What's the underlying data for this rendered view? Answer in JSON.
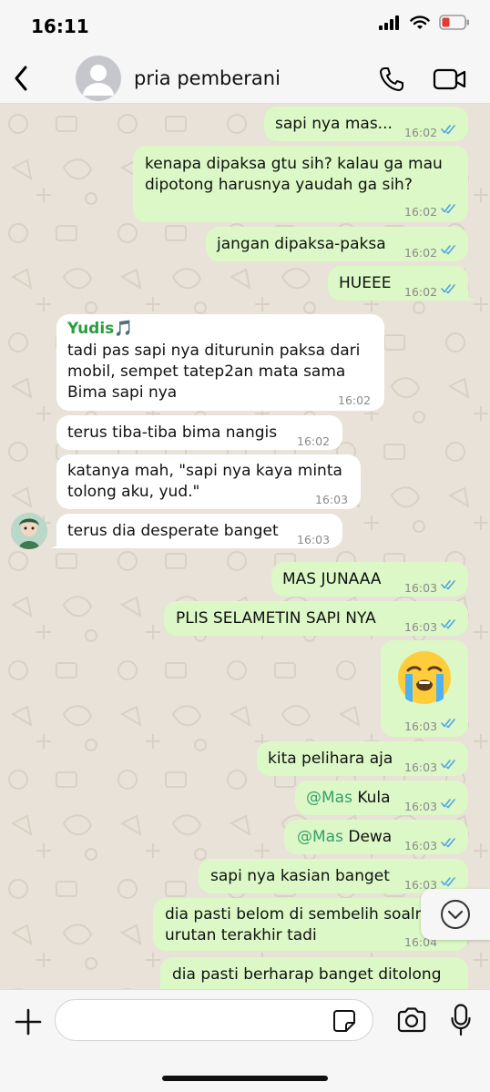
{
  "status_bar": {
    "time": "16:11"
  },
  "header": {
    "contact_name": "pria pemberani"
  },
  "messages": [
    {
      "dir": "out",
      "text": "sapi nya mas...",
      "time": "16:02"
    },
    {
      "dir": "out",
      "lines": [
        "kenapa dipaksa gtu sih? kalau ga mau",
        "dipotong harusnya yaudah ga sih?"
      ],
      "time": "16:02"
    },
    {
      "dir": "out",
      "text": "jangan dipaksa-paksa",
      "time": "16:02"
    },
    {
      "dir": "out",
      "text": "HUEEE",
      "time": "16:02"
    },
    {
      "dir": "in",
      "sender": "Yudis🎵",
      "lines": [
        "tadi pas sapi nya diturunin paksa dari",
        "mobil, sempet tatep2an mata sama",
        "Bima sapi nya"
      ],
      "time": "16:02"
    },
    {
      "dir": "in",
      "text": "terus tiba-tiba bima nangis",
      "time": "16:02"
    },
    {
      "dir": "in",
      "lines": [
        "katanya mah, \"sapi nya kaya minta",
        "tolong aku, yud.\""
      ],
      "time": "16:03"
    },
    {
      "dir": "in",
      "text": "terus dia desperate banget",
      "time": "16:03"
    },
    {
      "dir": "out",
      "text": "MAS JUNAAA",
      "time": "16:03"
    },
    {
      "dir": "out",
      "text": "PLIS SELAMETIN SAPI NYA",
      "time": "16:03"
    },
    {
      "dir": "out",
      "emoji": "😭",
      "time": "16:03"
    },
    {
      "dir": "out",
      "text": "kita pelihara aja",
      "time": "16:03"
    },
    {
      "dir": "out",
      "mention": "@Mas",
      "rest": " Kula",
      "time": "16:03"
    },
    {
      "dir": "out",
      "mention": "@Mas",
      "rest": " Dewa",
      "time": "16:03"
    },
    {
      "dir": "out",
      "text": "sapi nya kasian banget",
      "time": "16:03"
    },
    {
      "dir": "out",
      "lines": [
        "dia pasti belom di sembelih soalnya",
        "urutan terakhir tadi"
      ],
      "time": "16:04"
    },
    {
      "dir": "out",
      "text": "dia pasti berharap banget ditolong",
      "time": ""
    }
  ],
  "input": {
    "placeholder": ""
  },
  "colors": {
    "outgoing": "#dcf8c6",
    "incoming": "#ffffff",
    "tick": "#4fa3e8",
    "sender": "#2a9d3f",
    "wallpaper": "#e8e2d8"
  },
  "icons": [
    "back-icon",
    "avatar-placeholder-icon",
    "phone-icon",
    "video-icon",
    "read-ticks-icon",
    "chevron-down-icon",
    "plus-icon",
    "sticker-icon",
    "camera-icon",
    "mic-icon"
  ]
}
